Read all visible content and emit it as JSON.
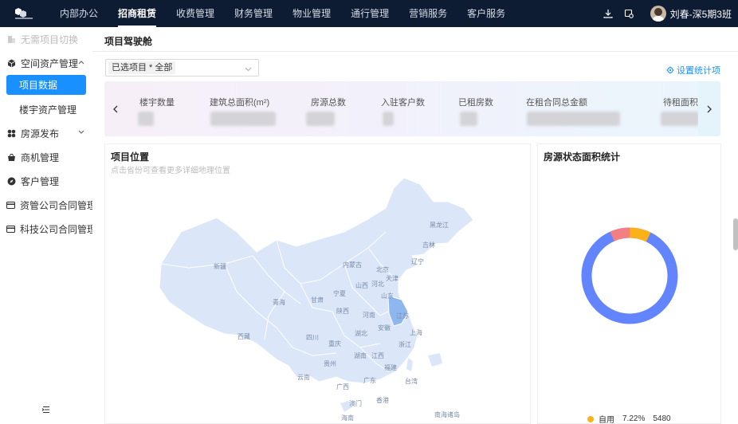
{
  "header": {
    "nav": [
      "内部办公",
      "招商租赁",
      "收费管理",
      "财务管理",
      "物业管理",
      "通行管理",
      "营销服务",
      "客户服务"
    ],
    "active_nav": 1,
    "username": "刘春-深5期3班"
  },
  "sidebar": {
    "switch_label": "无需项目切换",
    "items": [
      {
        "label": "空间资产管理",
        "icon": "cube-icon",
        "expanded": true
      },
      {
        "label": "房源发布",
        "icon": "grid-icon",
        "expanded": false
      },
      {
        "label": "商机管理",
        "icon": "bag-icon"
      },
      {
        "label": "客户管理",
        "icon": "compass-icon"
      },
      {
        "label": "资管公司合同管理",
        "icon": "card-icon"
      },
      {
        "label": "科技公司合同管理",
        "icon": "card-icon"
      }
    ],
    "subitems": [
      "项目数据",
      "楼宇资产管理"
    ]
  },
  "page": {
    "title": "项目驾驶舱",
    "select_value": "已选项目 * 全部",
    "settings_label": "设置统计项",
    "stats": [
      "楼宇数量",
      "建筑总面积(m²)",
      "房源总数",
      "入驻客户数",
      "已租房数",
      "在租合同总金额",
      "待租面积/可"
    ]
  },
  "map_panel": {
    "title": "项目位置",
    "subtitle": "点击省份可查看更多详细地理位置",
    "labels": [
      "黑龙江",
      "吉林",
      "辽宁",
      "内蒙古",
      "新疆",
      "青海",
      "西藏",
      "四川",
      "甘肃",
      "宁夏",
      "陕西",
      "山西",
      "河北",
      "北京",
      "天津",
      "山东",
      "河南",
      "安徽",
      "江苏",
      "上海",
      "湖北",
      "重庆",
      "浙江",
      "贵州",
      "湖南",
      "江西",
      "福建",
      "云南",
      "广西",
      "广东",
      "台湾",
      "香港",
      "澳门",
      "海南",
      "南海诸岛"
    ]
  },
  "donut_panel": {
    "title": "房源状态面积统计",
    "legend_label": "自用",
    "legend_percent": "7.22%",
    "legend_value": "5480",
    "colors": {
      "main": "#6384ff",
      "yellow": "#fab219",
      "pink": "#f47f83"
    }
  }
}
